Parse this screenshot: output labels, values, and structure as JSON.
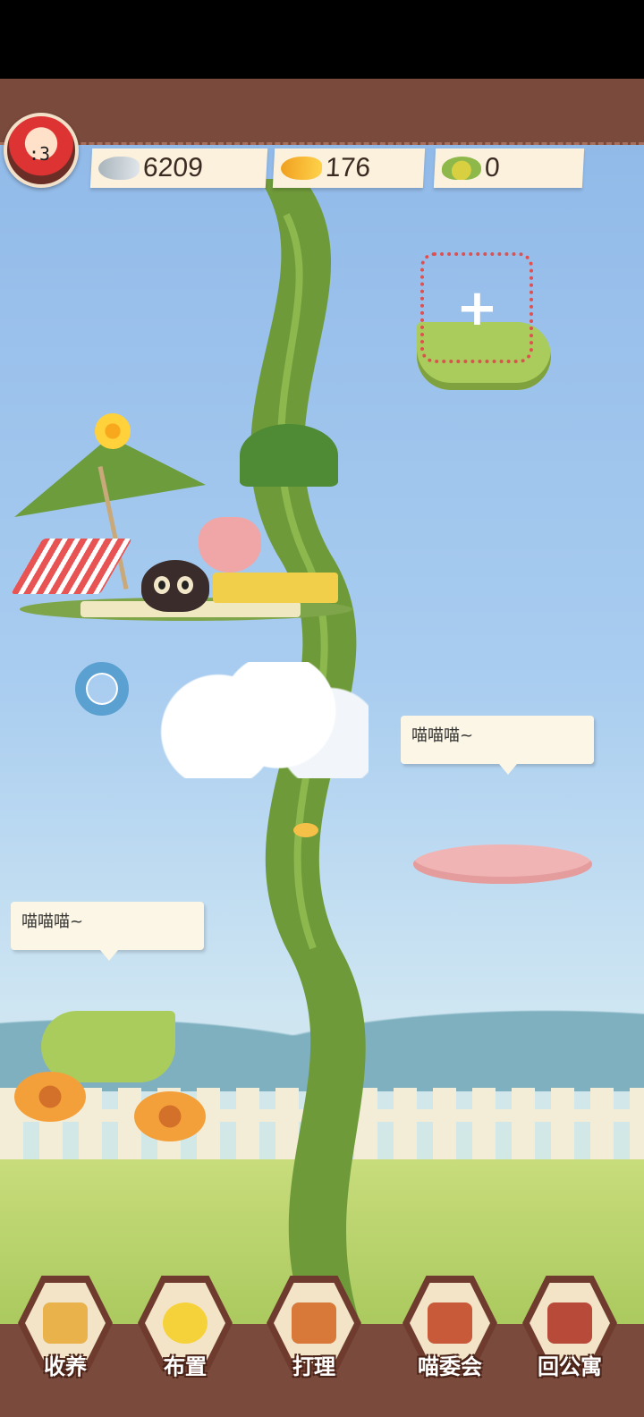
{
  "currencies": {
    "silver_fish": {
      "value": "6209",
      "icon": "silver-fish-icon"
    },
    "gold_fish": {
      "value": "176",
      "icon": "gold-fish-icon"
    },
    "bean": {
      "value": "0",
      "icon": "bean-icon"
    }
  },
  "speech_bubbles": [
    "喵喵喵~",
    "喵喵喵~"
  ],
  "add_slot": {
    "symbol": "+"
  },
  "avatar": {
    "face": ":3"
  },
  "nav": [
    {
      "label": "收养",
      "icon": "cat-basket-icon"
    },
    {
      "label": "布置",
      "icon": "flower-vase-icon"
    },
    {
      "label": "打理",
      "icon": "watering-can-icon"
    },
    {
      "label": "喵委会",
      "icon": "cat-house-icon"
    },
    {
      "label": "回公寓",
      "icon": "apartment-icon"
    }
  ],
  "colors": {
    "banner": "#7a4a3c",
    "stalk": "#6f9a3a",
    "accent_red": "#e05050"
  }
}
